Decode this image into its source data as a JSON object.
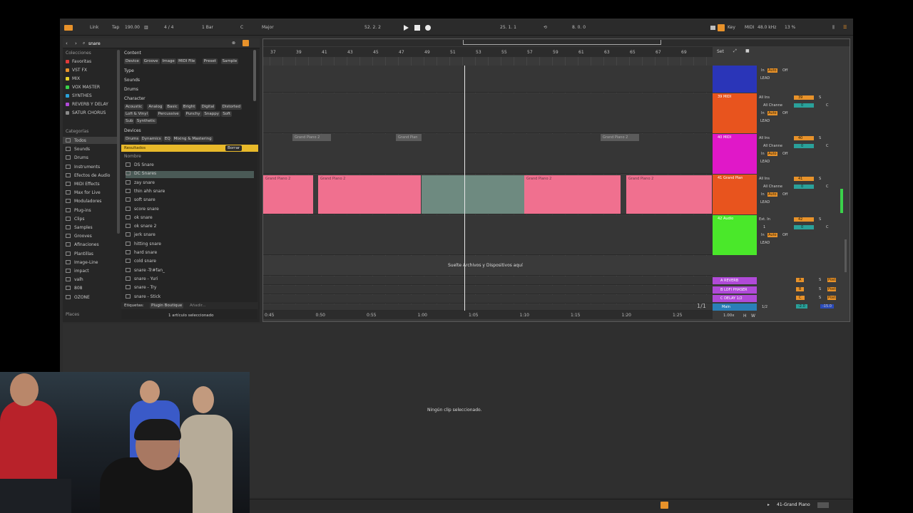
{
  "topbar": {
    "link": "Link",
    "tap": "Tap",
    "tempo": "190.00",
    "time_sig": "4 / 4",
    "quant": "1 Bar",
    "key": "C",
    "scale": "Major",
    "position": "52.  2.  2",
    "loop_start": "25.  1.  1",
    "loop_len": "8.  0.  0",
    "key_label": "Key",
    "midi_label": "MIDI",
    "sample_rate": "48.0 kHz",
    "cpu": "13 %"
  },
  "browser": {
    "search": "snare",
    "collections_title": "Colecciones",
    "collections": [
      {
        "label": "Favoritas",
        "color": "#e03a3a"
      },
      {
        "label": "VST FX",
        "color": "#e8922a"
      },
      {
        "label": "MIX",
        "color": "#e8d22a"
      },
      {
        "label": "VOX MASTER",
        "color": "#39d24a"
      },
      {
        "label": "SYNTHES",
        "color": "#2aa1d8"
      },
      {
        "label": "REVERB Y DELAY",
        "color": "#b04ad8"
      },
      {
        "label": "SATUR CHORUS",
        "color": "#8a8a8a"
      }
    ],
    "categories_title": "Categorías",
    "categories": [
      "Todos",
      "Sounds",
      "Drums",
      "Instruments",
      "Efectos de Audio",
      "MIDI Effects",
      "Max for Live",
      "Moduladores",
      "Plug-ins",
      "Clips",
      "Samples",
      "Grooves",
      "Afinaciones",
      "Plantillas",
      "Image-Line",
      "impact",
      "valh",
      "808",
      "OZONE"
    ],
    "places_title": "Places",
    "content_title": "Content",
    "content_chips": [
      "Device",
      "Groove",
      "Image",
      "MIDI File",
      "Preset",
      "Sample"
    ],
    "type_title": "Type",
    "sounds_title": "Sounds",
    "drums_title": "Drums",
    "character_title": "Character",
    "character_chips_1": [
      "Acoustic",
      "Analog",
      "Basic",
      "Bright",
      "Digital",
      "Distorted"
    ],
    "character_chips_2": [
      "Lofi & Vinyl",
      "Percussive",
      "Punchy",
      "Snappy",
      "Soft"
    ],
    "character_chips_3": [
      "Sub",
      "Synthetic"
    ],
    "devices_title": "Devices",
    "devices_chips": [
      "Drums",
      "Dynamics",
      "EQ",
      "Mixing & Mastering"
    ],
    "results_label": "Resultados",
    "clear_label": "Borrar",
    "name_header": "Nombre",
    "results": [
      "DS Snare",
      "DC Snares",
      "zay snare",
      "thin ahh snare",
      "soft snare",
      "score snare",
      "ok snare",
      "ok snare 2",
      "jerk snare",
      "hitting snare",
      "hard snare",
      "cold snare",
      "snare -Tr#fan_",
      "snare - Yuri",
      "snare - Try",
      "snare - Stick"
    ],
    "tags_label": "Etiquetas:",
    "tag_chip": "Plugin Boutique",
    "add_label": "Añadir...",
    "status": "1 artículo seleccionado"
  },
  "ruler": [
    "37",
    "39",
    "41",
    "43",
    "45",
    "47",
    "49",
    "51",
    "53",
    "55",
    "57",
    "59",
    "61",
    "63",
    "65",
    "67",
    "69"
  ],
  "set_label": "Set",
  "clips": {
    "gray": [
      "Grand Piano 2",
      "Grand Pian",
      "Grand Piano 2"
    ],
    "pink": [
      "Grand Piano 2",
      "Grand Piano 2",
      "Grand Piano 2",
      "Grand Piano 2"
    ]
  },
  "drop_hint": "Suelte Archivos y Dispositivos aquí",
  "timeline": [
    "0:45",
    "0:50",
    "0:55",
    "1:00",
    "1:05",
    "1:10",
    "1:15",
    "1:20",
    "1:25"
  ],
  "page_indicator": "1/1",
  "tracks": [
    {
      "name": "",
      "color": "#2a35b8",
      "input": "",
      "monitor": "",
      "sub": "LEAD"
    },
    {
      "name": "39 MIDI",
      "color": "#e8541e",
      "input": "All Ins",
      "monitor": "All Channe",
      "sub": "LEAD",
      "num": "39"
    },
    {
      "name": "40 MIDI",
      "color": "#e018c8",
      "input": "All Ins",
      "monitor": "All Channe",
      "sub": "LEAD",
      "num": "40"
    },
    {
      "name": "41 Grand Pian",
      "color": "#e8541e",
      "input": "All Ins",
      "monitor": "All Channe",
      "sub": "LEAD",
      "num": "41"
    },
    {
      "name": "42 Audio",
      "color": "#4ae82a",
      "input": "Ext. In",
      "monitor": "1",
      "sub": "LEAD",
      "num": "42"
    }
  ],
  "returns": [
    {
      "name": "A REVERB",
      "letter": "A"
    },
    {
      "name": "B LOFI PHASER",
      "letter": "B"
    },
    {
      "name": "C DELAY 1/2",
      "letter": "C"
    }
  ],
  "main": {
    "name": "Main",
    "vol": "-2.0",
    "pan": "1/2",
    "gain": "-15.0",
    "zoom": "1.00x"
  },
  "mixer_labels": {
    "auto": "Auto",
    "off": "Off",
    "in": "In",
    "s": "S",
    "c": "C",
    "post": "Post",
    "zero": "0",
    "h": "H",
    "w": "W"
  },
  "detail": {
    "empty": "Ningún clip seleccionado."
  },
  "bottombar": {
    "track": "41-Grand Piano"
  }
}
